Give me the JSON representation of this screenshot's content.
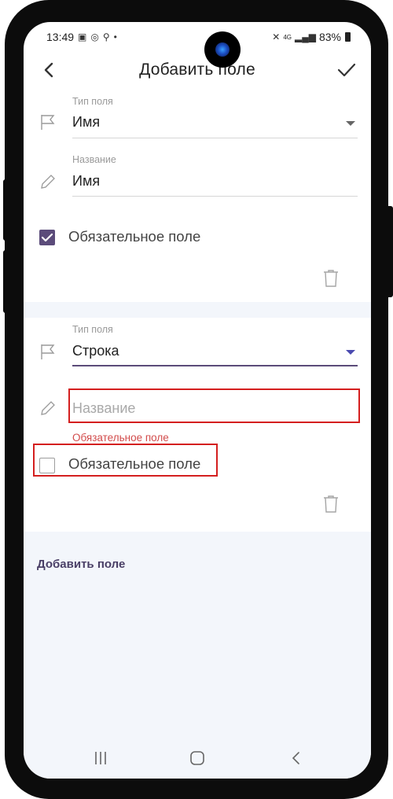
{
  "status": {
    "time": "13:49",
    "battery": "83%",
    "network": "4G"
  },
  "appbar": {
    "title": "Добавить поле",
    "back_icon": "chevron-left-icon",
    "confirm_icon": "check-icon"
  },
  "fields": [
    {
      "type_label": "Тип поля",
      "type_value": "Имя",
      "name_label": "Название",
      "name_value": "Имя",
      "required_label": "Обязательное поле",
      "required_checked": true
    },
    {
      "type_label": "Тип поля",
      "type_value": "Строка",
      "name_placeholder": "Название",
      "name_value": "",
      "error_text": "Обязательное поле",
      "required_label": "Обязательное поле",
      "required_checked": false
    }
  ],
  "add_field_label": "Добавить поле",
  "colors": {
    "accent": "#5b4b7a",
    "error": "#d24b4b",
    "highlight": "#d41f1f",
    "background": "#f3f6fb"
  }
}
